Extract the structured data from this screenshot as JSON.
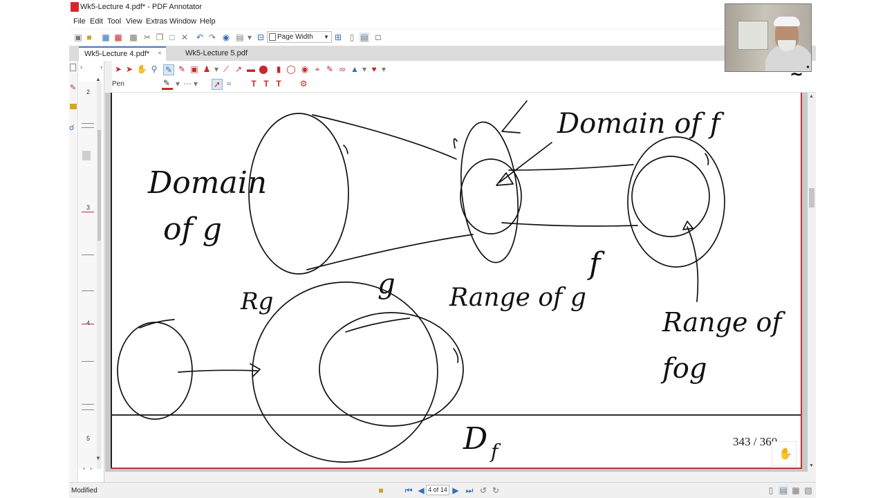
{
  "window": {
    "title": "Wk5-Lecture 4.pdf* - PDF Annotator"
  },
  "menu": [
    "File",
    "Edit",
    "Tool",
    "View",
    "Extras",
    "Window",
    "Help"
  ],
  "toolbar": {
    "zoom_value": "Page Width"
  },
  "tabs": [
    {
      "label": "Wk5-Lecture 4.pdf*",
      "active": true
    },
    {
      "label": "Wk5-Lecture 5.pdf",
      "active": false
    }
  ],
  "annotation_tools": {
    "current_tool_label": "Pen",
    "pen_color": "#c62828"
  },
  "sidebar": {
    "page_numbers": [
      "2",
      "3",
      "4",
      "5"
    ]
  },
  "page": {
    "handwriting": {
      "domain_g_1": "Domain",
      "domain_g_2": "of g",
      "domain_f": "Domain of f",
      "g": "g",
      "f": "f",
      "rg": "Rg",
      "range_g": "Range of g",
      "range_fog_1": "Range of",
      "range_fog_2": "fog",
      "df_main": "D",
      "df_sub": "f"
    },
    "counter": "343 / 360"
  },
  "navigation": {
    "page_indicator": "4 of 14"
  },
  "status": {
    "text": "Modified"
  },
  "webcam": {
    "icon": "person-video-feed"
  }
}
